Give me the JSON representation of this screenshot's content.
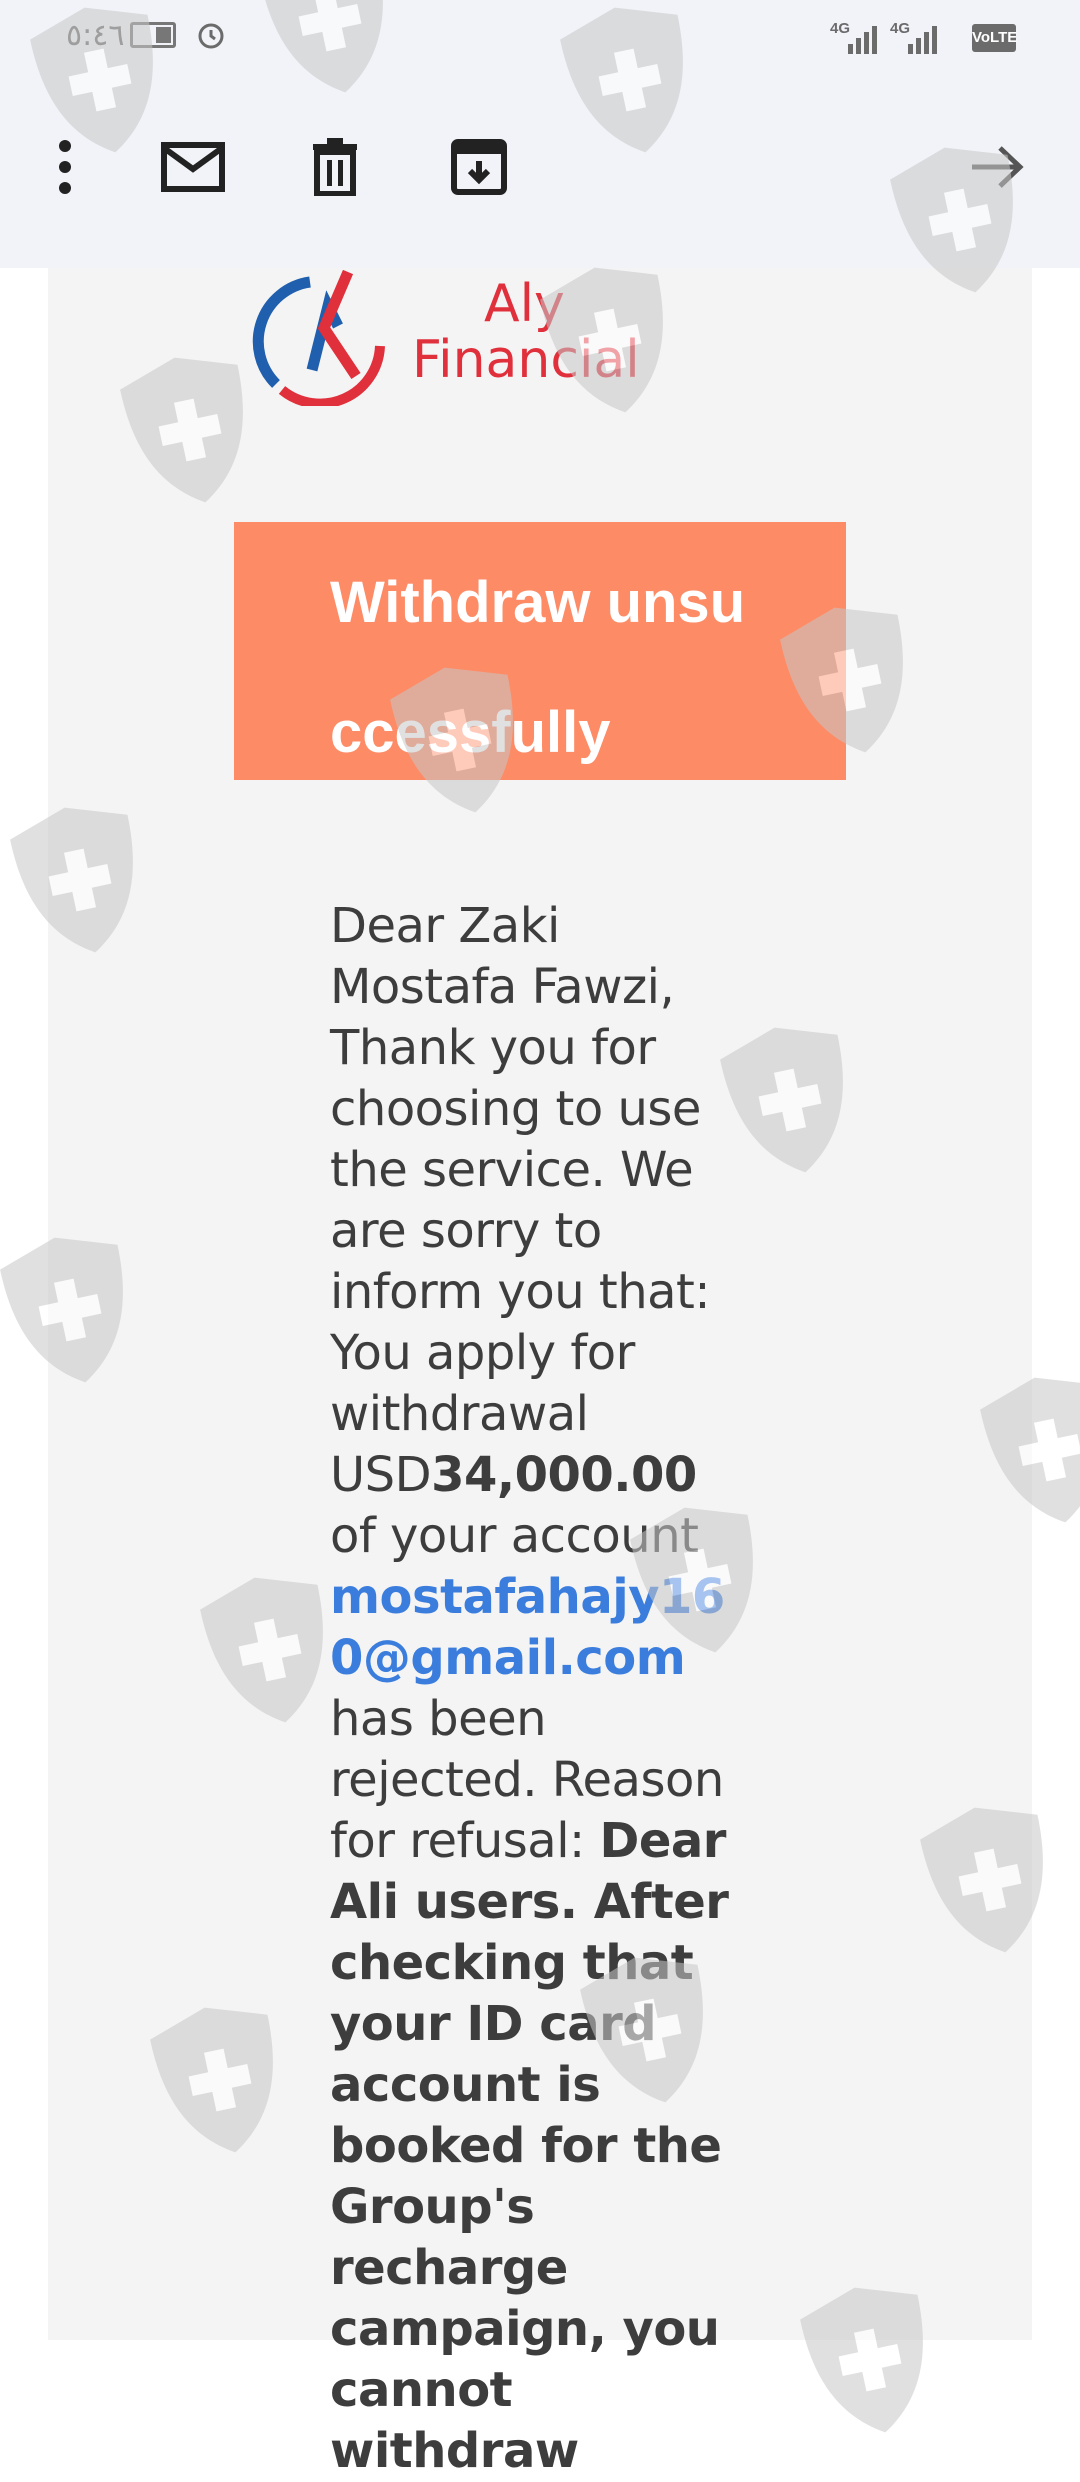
{
  "status_bar": {
    "time": "٥:٤٦",
    "network_1": "4G",
    "network_2": "4G",
    "volte": "VoLTE",
    "battery_level": 0.4
  },
  "toolbar": {
    "more_icon": "more-vert-icon",
    "mail_icon": "mark-unread-icon",
    "delete_icon": "trash-icon",
    "archive_icon": "archive-icon",
    "forward_icon": "arrow-right-icon"
  },
  "email": {
    "logo_line1": "Aly",
    "logo_line2": "Financial",
    "banner_title": "Withdraw unsuccessfully",
    "banner_color": "#fd8b66",
    "body": {
      "p1": "Dear Zaki Mostafa Fawzi, Thank you for choosing to use the service. We are sorry to inform you that: You apply for withdrawal USD",
      "amount": "34,000.00",
      "p2": " of your account ",
      "email_link": "mostafahajy160@gmail.com",
      "p3": " has been rejected. Reason for refusal: ",
      "reason": "Dear Ali users. After checking that your ID card account is booked for the Group's recharge campaign, you cannot withdraw"
    },
    "link_color": "#3b7ddd"
  }
}
